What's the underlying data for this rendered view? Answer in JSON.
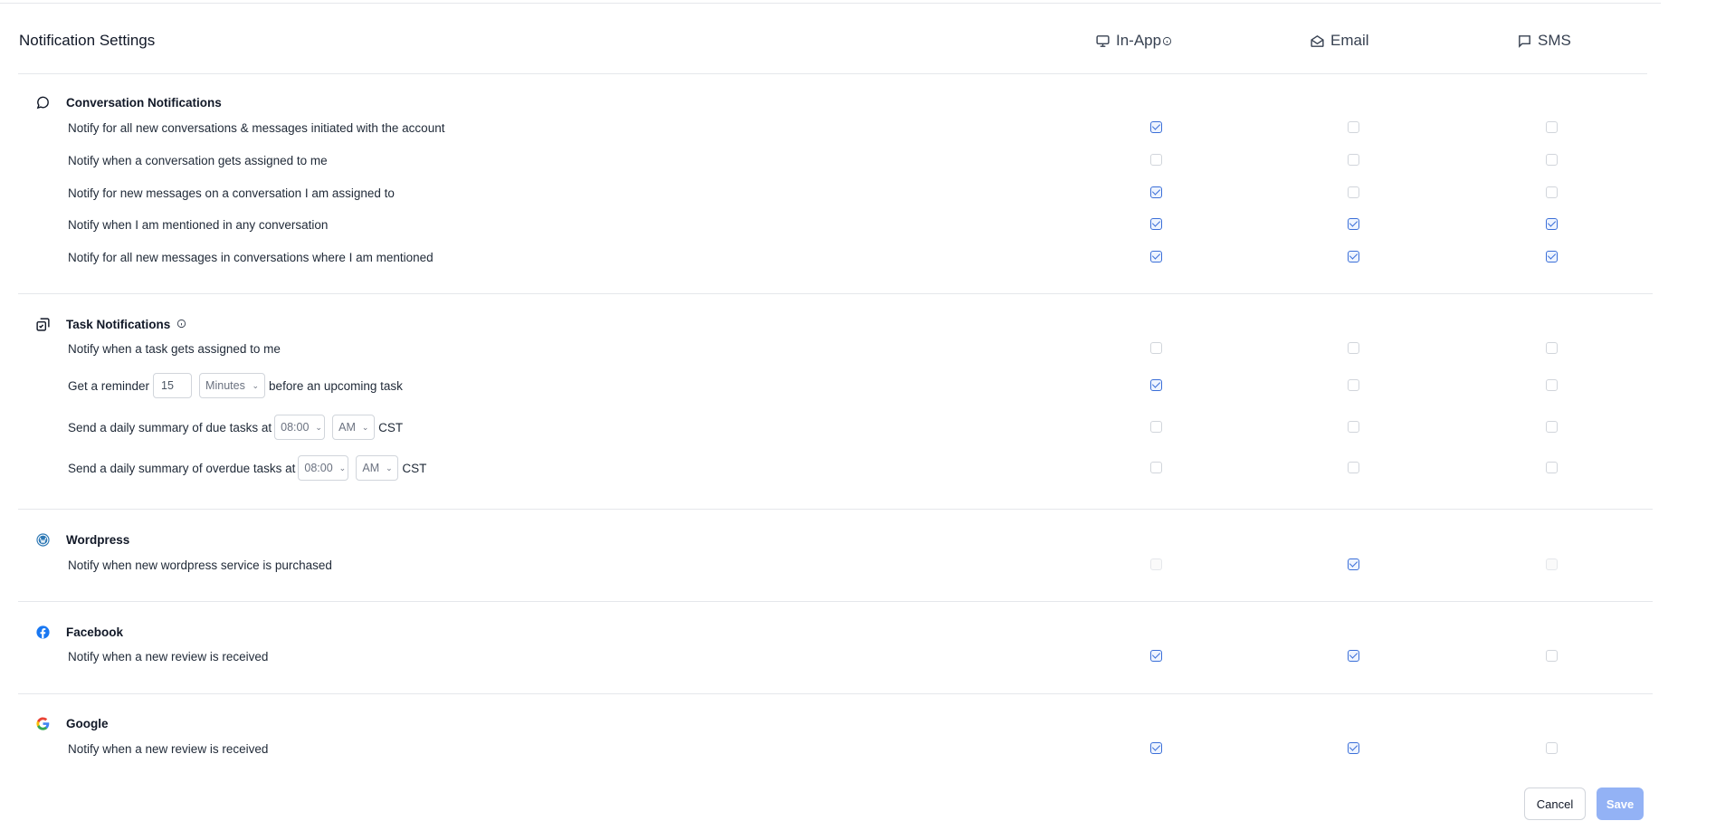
{
  "header": {
    "title": "Notification Settings",
    "columns": [
      {
        "label": "In-App",
        "icon": "monitor-icon",
        "info_icon": "info-icon"
      },
      {
        "label": "Email",
        "icon": "envelope-open-icon"
      },
      {
        "label": "SMS",
        "icon": "message-square-icon"
      }
    ]
  },
  "sections": [
    {
      "title": "Conversation Notifications",
      "icon": "chat-bubble-icon",
      "rows": [
        {
          "label": "Notify for all new conversations & messages initiated with the account",
          "in_app": true,
          "email": false,
          "sms": false
        },
        {
          "label": "Notify when a conversation gets assigned to me",
          "in_app": false,
          "email": false,
          "sms": false
        },
        {
          "label": "Notify for new messages on a conversation I am assigned to",
          "in_app": true,
          "email": false,
          "sms": false
        },
        {
          "label": "Notify when I am mentioned in any conversation",
          "in_app": true,
          "email": true,
          "sms": true
        },
        {
          "label": "Notify for all new messages in conversations where I am mentioned",
          "in_app": true,
          "email": true,
          "sms": true
        }
      ]
    },
    {
      "title": "Task Notifications",
      "icon": "task-copy-icon",
      "info_icon": "info-icon",
      "rows": [
        {
          "label": "Notify when a task gets assigned to me",
          "in_app": false,
          "email": false,
          "sms": false
        },
        {
          "label_before": "Get a reminder",
          "reminder_value": "15",
          "reminder_unit": "Minutes",
          "label_after": "before an upcoming task",
          "in_app": true,
          "email": false,
          "sms": false
        },
        {
          "label_before": "Send a daily summary of due tasks at",
          "time": "08:00",
          "ampm": "AM",
          "timezone": "CST",
          "in_app": false,
          "email": false,
          "sms": false
        },
        {
          "label_before": "Send a daily summary of overdue tasks at",
          "time": "08:00",
          "ampm": "AM",
          "timezone": "CST",
          "in_app": false,
          "email": false,
          "sms": false
        }
      ]
    },
    {
      "title": "Wordpress",
      "icon": "wordpress-icon",
      "rows": [
        {
          "label": "Notify when new wordpress service is purchased",
          "in_app": false,
          "in_app_disabled": true,
          "email": true,
          "sms": false,
          "sms_disabled": true
        }
      ]
    },
    {
      "title": "Facebook",
      "icon": "facebook-icon",
      "rows": [
        {
          "label": "Notify when a new review is received",
          "in_app": true,
          "email": true,
          "sms": false
        }
      ]
    },
    {
      "title": "Google",
      "icon": "google-icon",
      "rows": [
        {
          "label": "Notify when a new review is received",
          "in_app": true,
          "email": true,
          "sms": false
        }
      ]
    }
  ],
  "footer": {
    "cancel_label": "Cancel",
    "save_label": "Save"
  },
  "colors": {
    "accent": "#3b6fd8",
    "save_button": "#93b2f5",
    "divider": "#e5e7eb"
  }
}
